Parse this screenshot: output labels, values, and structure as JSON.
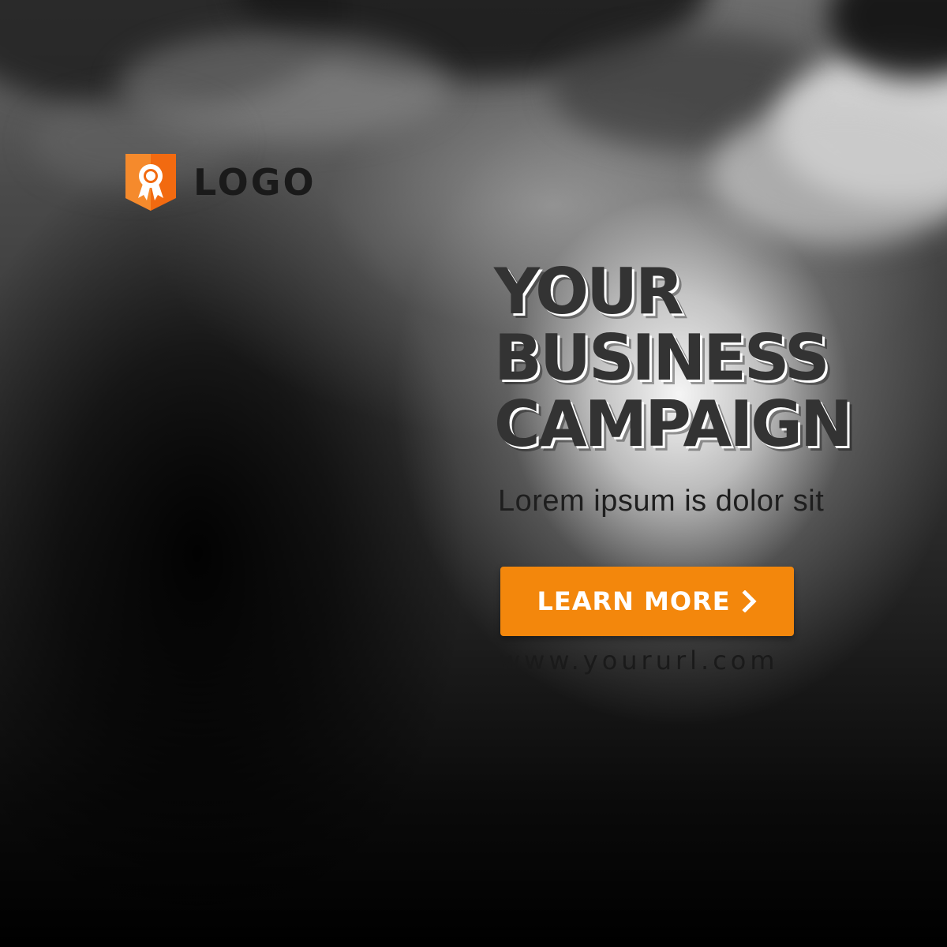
{
  "brand": {
    "logo_text": "LOGO",
    "accent_color": "#f3870c",
    "logo_icon": "award-ribbon-icon"
  },
  "hero": {
    "headline_lines": [
      "YOUR",
      "BUSINESS",
      "CAMPAIGN"
    ],
    "subtitle": "Lorem ipsum is dolor sit"
  },
  "cta": {
    "label": "LEARN MORE",
    "icon": "chevron-right-icon"
  },
  "footer": {
    "url": "www.yoururl.com"
  }
}
